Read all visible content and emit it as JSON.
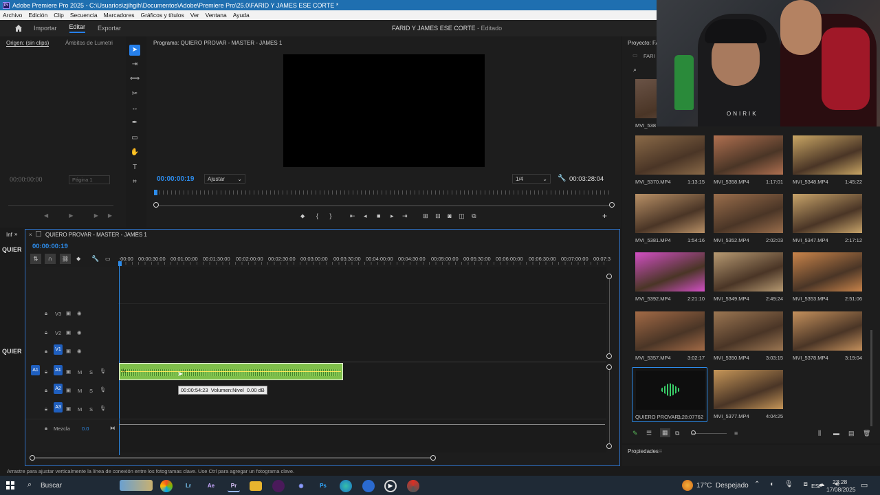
{
  "title_bar": {
    "text": "Adobe Premiere Pro 2025 - C:\\Usuarios\\zjihgih\\Documentos\\Adobe\\Premiere Pro\\25.0\\FARID Y JAMES ESE CORTE *"
  },
  "menu": [
    "Archivo",
    "Edición",
    "Clip",
    "Secuencia",
    "Marcadores",
    "Gráficos y títulos",
    "Ver",
    "Ventana",
    "Ayuda"
  ],
  "workspaces": {
    "import": "Importar",
    "edit": "Editar",
    "export": "Exportar"
  },
  "project_title": {
    "name": "FARID Y JAMES ESE CORTE",
    "status": "- Editado"
  },
  "source_panel": {
    "tab1": "Origen: (sin clips)",
    "tab2": "Ámbitos de Lumetri",
    "timecode": "00:00:00:00",
    "page": "Página 1"
  },
  "program_panel": {
    "title": "Programa: QUIERO PROVAR - MASTER - JAMES 1",
    "timecode": "00:00:00:19",
    "fit": "Ajustar",
    "resolution": "1/4",
    "duration": "00:03:28:04"
  },
  "timeline": {
    "tab_short": "Inf",
    "sequence": "QUIERO PROVAR - MASTER - JAMES 1",
    "timecode": "00:00:00:19",
    "ruler": [
      ":00:00",
      "00:00:30:00",
      "00:01:00:00",
      "00:01:30:00",
      "00:02:00:00",
      "00:02:30:00",
      "00:03:00:00",
      "00:03:30:00",
      "00:04:00:00",
      "00:04:30:00",
      "00:05:00:00",
      "00:05:30:00",
      "00:06:00:00",
      "00:06:30:00",
      "00:07:00:00",
      "00:07:3"
    ],
    "tracks": {
      "v3": "V3",
      "v2": "V2",
      "v1": "V1",
      "a1_src": "A1",
      "a1": "A1",
      "a2": "A2",
      "a3": "A3",
      "m": "M",
      "s": "S"
    },
    "mix": {
      "label": "Mezcla",
      "value": "0.0"
    },
    "tooltip": {
      "time": "00:00:54:23",
      "label": "Volumen:Nivel",
      "value": "0.00 dB"
    },
    "side_label": "QUIER"
  },
  "project_panel": {
    "title": "Proyecto: FA",
    "folder": "FARI",
    "clips": [
      {
        "name": "MVI_538",
        "dur": "",
        "color": "#6a5346"
      },
      {
        "name": "MVI_5370.MP4",
        "dur": "1:13:15",
        "color": "#8a6a48"
      },
      {
        "name": "MVI_5358.MP4",
        "dur": "1:17:01",
        "color": "#b07050"
      },
      {
        "name": "MVI_5348.MP4",
        "dur": "1:45:22",
        "color": "#c9a664"
      },
      {
        "name": "MVI_5381.MP4",
        "dur": "1:54:16",
        "color": "#b89066"
      },
      {
        "name": "MVI_5352.MP4",
        "dur": "2:02:03",
        "color": "#9a6e4c"
      },
      {
        "name": "MVI_5347.MP4",
        "dur": "2:17:12",
        "color": "#c8a46a"
      },
      {
        "name": "MVI_5392.MP4",
        "dur": "2:21:10",
        "color": "#d24fc4"
      },
      {
        "name": "MVI_5349.MP4",
        "dur": "2:49:24",
        "color": "#b79a72"
      },
      {
        "name": "MVI_5353.MP4",
        "dur": "2:51:06",
        "color": "#c9844a"
      },
      {
        "name": "MVI_5357.MP4",
        "dur": "3:02:17",
        "color": "#a26a46"
      },
      {
        "name": "MVI_5350.MP4",
        "dur": "3:03:15",
        "color": "#9b7652"
      },
      {
        "name": "MVI_5378.MP4",
        "dur": "3:19:04",
        "color": "#c4905c"
      },
      {
        "name": "QUIERO PROVAR...",
        "dur": "3:28:07762",
        "color": "#0e0e0e"
      },
      {
        "name": "MVI_5377.MP4",
        "dur": "4:04:25",
        "color": "#c69658"
      }
    ],
    "properties": "Propiedades"
  },
  "webcam": {
    "shirt_text": "ONIRIK"
  },
  "status_bar": "Arrastre para ajustar verticalmente la línea de conexión entre los fotogramas clave. Use Ctrl para agregar un fotograma clave.",
  "taskbar": {
    "search": "Buscar",
    "weather": "17°C  Despejado",
    "lang": "ESP",
    "time": "23:28",
    "date": "17/08/2025",
    "apps": [
      {
        "label": "Lr",
        "color": "#0b2a4a"
      },
      {
        "label": "Ae",
        "color": "#1a1240"
      },
      {
        "label": "Pr",
        "color": "#1b1258"
      },
      {
        "label": "Ps",
        "color": "#0a1f3a"
      }
    ]
  }
}
